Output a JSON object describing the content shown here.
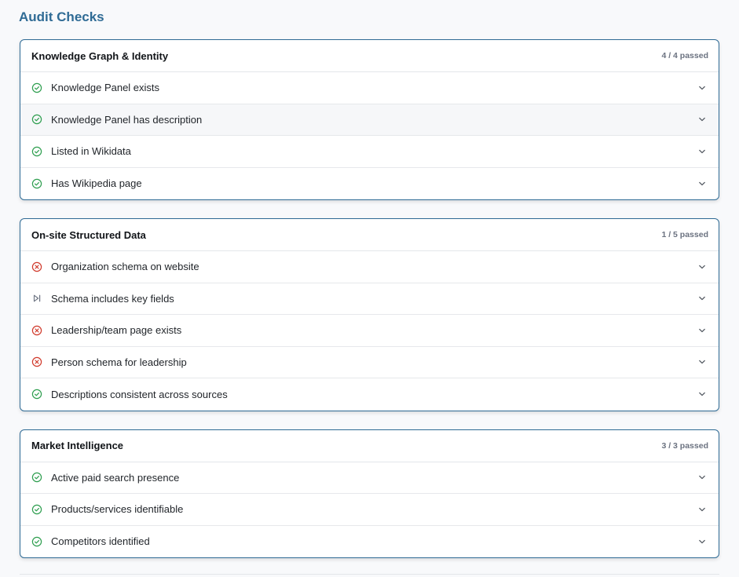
{
  "page": {
    "title": "Audit Checks"
  },
  "colors": {
    "pass": "#2e9e4f",
    "fail": "#d0392b",
    "skip": "#6b7280",
    "accent": "#2f6b95"
  },
  "sections": [
    {
      "title": "Knowledge Graph & Identity",
      "summary": "4 / 4 passed",
      "checks": [
        {
          "label": "Knowledge Panel exists",
          "status": "pass",
          "icon": "check-circle-icon"
        },
        {
          "label": "Knowledge Panel has description",
          "status": "pass",
          "icon": "check-circle-icon"
        },
        {
          "label": "Listed in Wikidata",
          "status": "pass",
          "icon": "check-circle-icon"
        },
        {
          "label": "Has Wikipedia page",
          "status": "pass",
          "icon": "check-circle-icon"
        }
      ]
    },
    {
      "title": "On-site Structured Data",
      "summary": "1 / 5 passed",
      "checks": [
        {
          "label": "Organization schema on website",
          "status": "fail",
          "icon": "x-circle-icon"
        },
        {
          "label": "Schema includes key fields",
          "status": "skip",
          "icon": "skip-icon"
        },
        {
          "label": "Leadership/team page exists",
          "status": "fail",
          "icon": "x-circle-icon"
        },
        {
          "label": "Person schema for leadership",
          "status": "fail",
          "icon": "x-circle-icon"
        },
        {
          "label": "Descriptions consistent across sources",
          "status": "pass",
          "icon": "check-circle-icon"
        }
      ]
    },
    {
      "title": "Market Intelligence",
      "summary": "3 / 3 passed",
      "checks": [
        {
          "label": "Active paid search presence",
          "status": "pass",
          "icon": "check-circle-icon"
        },
        {
          "label": "Products/services identifiable",
          "status": "pass",
          "icon": "check-circle-icon"
        },
        {
          "label": "Competitors identified",
          "status": "pass",
          "icon": "check-circle-icon"
        }
      ]
    }
  ]
}
